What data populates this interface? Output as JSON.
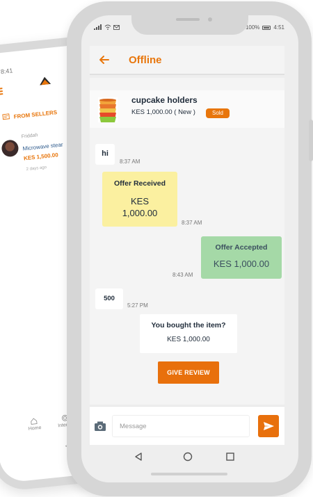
{
  "back_phone": {
    "time": "8:41",
    "sellers_label": "FROM SELLERS",
    "listing": {
      "seller": "Friddah",
      "title": "Microwave stear",
      "price": "KES 1,500.00",
      "ago": "2 days ago"
    },
    "nav": [
      {
        "label": "Home",
        "icon": "home-icon"
      },
      {
        "label": "Interest",
        "icon": "target-icon"
      }
    ]
  },
  "status_bar": {
    "battery": "100%",
    "time": "4:51"
  },
  "header": {
    "title": "Offline"
  },
  "product": {
    "name": "cupcake holders",
    "price_line": "KES 1,000.00 ( New )",
    "badge": "Sold"
  },
  "messages": {
    "hi": {
      "text": "hi",
      "time": "8:37 AM"
    },
    "offer_received": {
      "title": "Offer Received",
      "currency": "KES",
      "amount": "1,000.00",
      "time": "8:37 AM"
    },
    "offer_accepted": {
      "title": "Offer Accepted",
      "amount": "KES  1,000.00",
      "time": "8:43 AM"
    },
    "five_hundred": {
      "text": "500",
      "time": "5:27 PM"
    },
    "bought": {
      "title": "You bought the item?",
      "amount": "KES  1,000.00"
    }
  },
  "review_button": "GIVE REVIEW",
  "composer": {
    "placeholder": "Message"
  },
  "colors": {
    "accent": "#e8760c",
    "offer_received_bg": "#fbf0a0",
    "offer_accepted_bg": "#a5d9a7",
    "text_dark": "#222e3c"
  }
}
